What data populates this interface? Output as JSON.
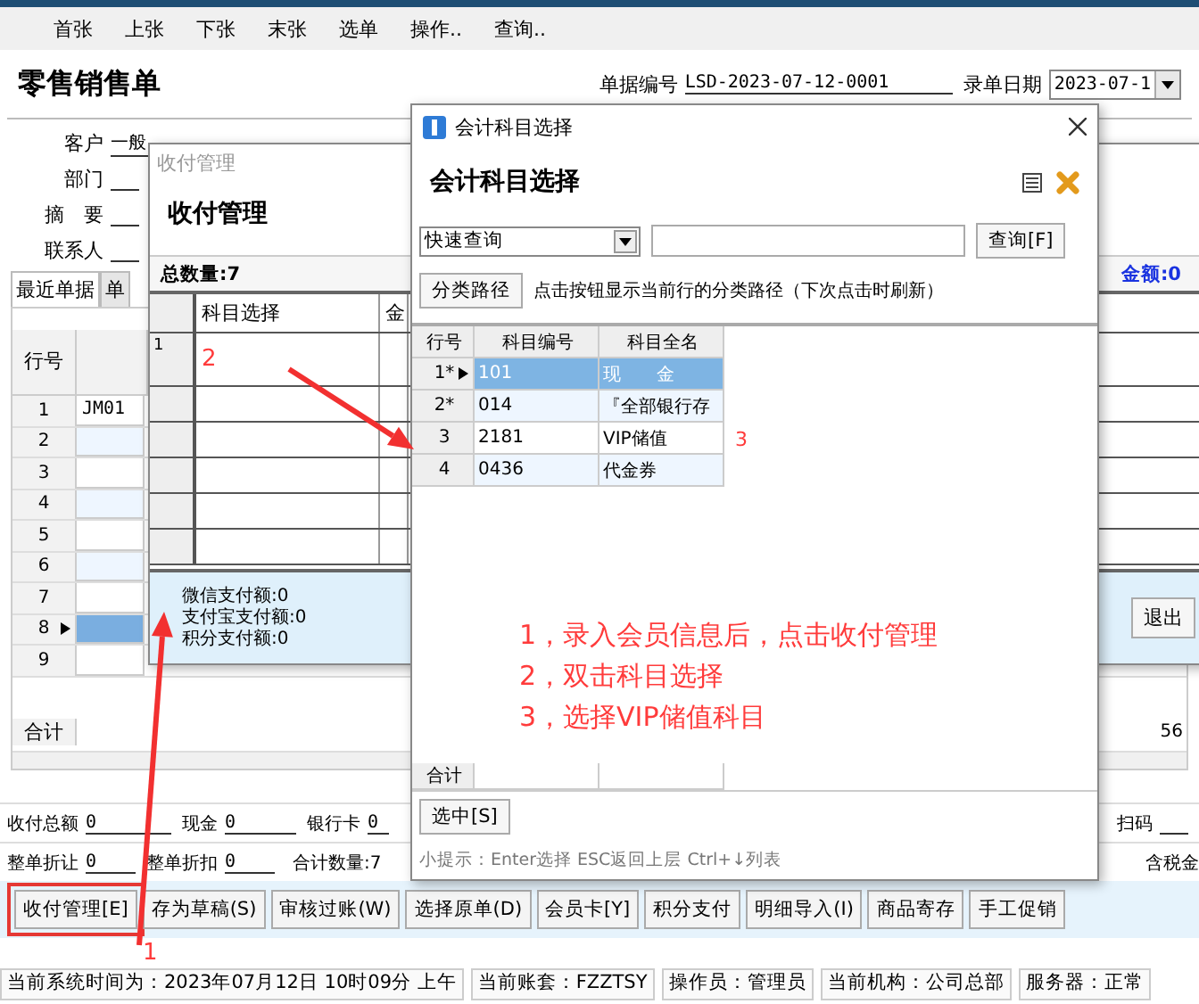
{
  "menu": [
    "首张",
    "上张",
    "下张",
    "末张",
    "选单",
    "操作..",
    "查询.."
  ],
  "document": {
    "title": "零售销售单",
    "number_label": "单据编号",
    "number": "LSD-2023-07-12-0001",
    "date_label": "录单日期",
    "date": "2023-07-1"
  },
  "form": [
    {
      "label": "客户",
      "value": "一般"
    },
    {
      "label": "部门"
    },
    {
      "label": "摘　要"
    },
    {
      "label": "联系人"
    }
  ],
  "tabs": [
    {
      "label": "最近单据",
      "selected": true
    },
    {
      "label": "单",
      "selected": false
    }
  ],
  "grid": {
    "columns": [
      "行号"
    ],
    "total_label": "合计",
    "total_value": "56",
    "rows": [
      {
        "no": "1",
        "code": "JM01",
        "selected": false
      },
      {
        "no": "2",
        "selected": false
      },
      {
        "no": "3",
        "selected": false
      },
      {
        "no": "4",
        "selected": false
      },
      {
        "no": "5",
        "selected": false
      },
      {
        "no": "6",
        "selected": false
      },
      {
        "no": "7",
        "selected": false
      },
      {
        "no": "8",
        "selected": true
      },
      {
        "no": "9",
        "selected": false
      }
    ]
  },
  "payment_fields": [
    {
      "label": "收付总额",
      "value": "0"
    },
    {
      "label": "现金",
      "value": "0"
    },
    {
      "label": "银行卡",
      "value": "0"
    },
    {
      "label": "扫码"
    }
  ],
  "discount_fields": [
    {
      "label": "整单折让",
      "value": "0",
      "kind": "field"
    },
    {
      "label": "整单折扣",
      "value": "0",
      "kind": "field"
    },
    {
      "label": "合计数量:7",
      "kind": "text"
    },
    {
      "label": "含税金",
      "kind": "text"
    }
  ],
  "buttons": [
    {
      "label": "收付管理[E]",
      "highlighted": true
    },
    {
      "label": "存为草稿(S)",
      "highlighted": false
    },
    {
      "label": "审核过账(W)",
      "highlighted": false
    },
    {
      "label": "选择原单(D)",
      "highlighted": false
    },
    {
      "label": "会员卡[Y]",
      "highlighted": false
    },
    {
      "label": "积分支付",
      "highlighted": false
    },
    {
      "label": "明细导入(I)",
      "highlighted": false
    },
    {
      "label": "商品寄存",
      "highlighted": false
    },
    {
      "label": "手工促销",
      "highlighted": false
    }
  ],
  "status_bar": [
    "当前系统时间为：2023年07月12日 10时09分 上午",
    "当前账套：FZZTSY",
    "操作员：管理员",
    "当前机构：公司总部",
    "服务器：正常"
  ],
  "payment_window": {
    "title": "收付管理",
    "heading": "收付管理",
    "total_qty": "总数量:7",
    "amount": "金额:0",
    "columns": [
      "科目选择",
      "金"
    ],
    "rows": [
      {
        "no": "1",
        "note": "2"
      },
      {},
      {},
      {},
      {},
      {}
    ],
    "summary": [
      "微信支付额:0",
      "支付宝支付额:0",
      "积分支付额:0"
    ],
    "exit_button": "退出"
  },
  "account_dialog": {
    "title": "会计科目选择",
    "heading": "会计科目选择",
    "mode": "快速查询",
    "search_button": "查询[F]",
    "path_button": "分类路径",
    "path_hint": "点击按钮显示当前行的分类路径（下次点击时刷新）",
    "columns": [
      "行号",
      "科目编号",
      "科目全名"
    ],
    "rows": [
      {
        "no": "1*",
        "code": "101",
        "name": "现　　金",
        "selected": true
      },
      {
        "no": "2*",
        "code": "014",
        "name": "『全部银行存",
        "selected": false
      },
      {
        "no": "3",
        "code": "2181",
        "name": "VIP储值",
        "selected": false,
        "note": "3"
      },
      {
        "no": "4",
        "code": "0436",
        "name": "代金券",
        "selected": false
      }
    ],
    "total_label": "合计",
    "select_button": "选中[S]",
    "tip": "小提示：Enter选择 ESC返回上层 Ctrl+↓列表"
  },
  "instructions": [
    "1，录入会员信息后，点击收付管理",
    "2，双击科目选择",
    "3，选择VIP储值科目"
  ],
  "button_note": "1"
}
